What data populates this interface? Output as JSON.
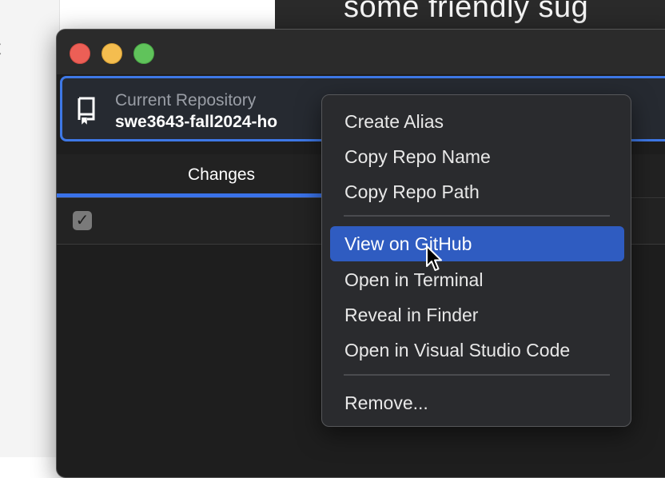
{
  "background": {
    "left_text": "t",
    "dark_text": "some friendly sug"
  },
  "window": {
    "repository": {
      "label": "Current Repository",
      "name": "swe3643-fall2024-ho"
    },
    "tabs": {
      "changes": "Changes"
    },
    "checkbox_glyph": "✓"
  },
  "context_menu": {
    "items": [
      {
        "label": "Create Alias"
      },
      {
        "label": "Copy Repo Name"
      },
      {
        "label": "Copy Repo Path"
      },
      {
        "label": "View on GitHub"
      },
      {
        "label": "Open in Terminal"
      },
      {
        "label": "Reveal in Finder"
      },
      {
        "label": "Open in Visual Studio Code"
      },
      {
        "label": "Remove..."
      }
    ]
  },
  "colors": {
    "accent": "#3e78e6",
    "menu_highlight": "#2f5cc1"
  },
  "icons": {
    "repo": "repo-icon",
    "cursor": "mouse-pointer-icon"
  }
}
